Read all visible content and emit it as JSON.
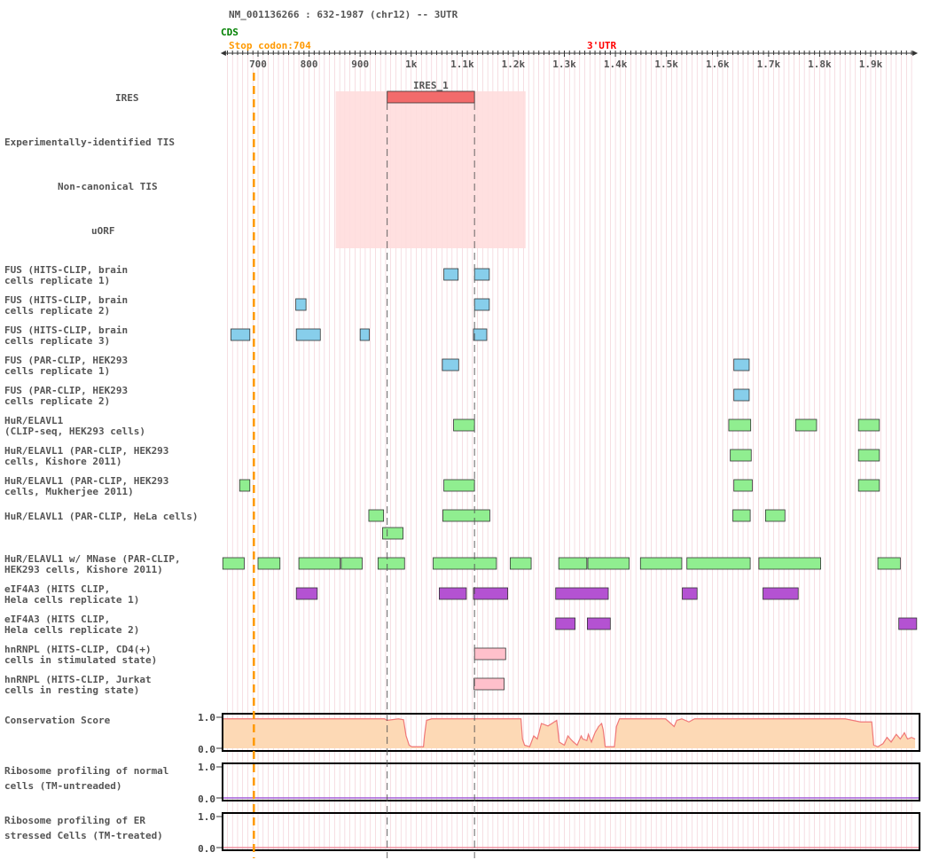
{
  "header": {
    "transcript": "NM_001136266 : 632-1987 (chr12) -- 3UTR",
    "cds_label": "CDS",
    "stop_codon_label": "Stop codon:704",
    "utr_label": "3'UTR"
  },
  "colors": {
    "cds": "#008000",
    "stop": "#ff9900",
    "utr": "#ff0000",
    "ires_fill": "#f26b6b",
    "ires_region": "#ffdddd",
    "fus": "#87ceeb",
    "hur": "#90ee90",
    "eif4a3": "#b452d2",
    "hnrnpl": "#ffc0cb",
    "conservation_fill": "#fdd9b5",
    "conservation_line": "#f07878",
    "ribo_normal": "#a05ad6",
    "ribo_er": "#f090a0",
    "grid": "#f0c8d0"
  },
  "chart_data": {
    "type": "genome-track",
    "x_range": [
      632,
      1987
    ],
    "ticks": [
      {
        "pos": 700,
        "label": "700"
      },
      {
        "pos": 800,
        "label": "800"
      },
      {
        "pos": 900,
        "label": "900"
      },
      {
        "pos": 1000,
        "label": "1k"
      },
      {
        "pos": 1100,
        "label": "1.1k"
      },
      {
        "pos": 1200,
        "label": "1.2k"
      },
      {
        "pos": 1300,
        "label": "1.3k"
      },
      {
        "pos": 1400,
        "label": "1.4k"
      },
      {
        "pos": 1500,
        "label": "1.5k"
      },
      {
        "pos": 1600,
        "label": "1.6k"
      },
      {
        "pos": 1700,
        "label": "1.7k"
      },
      {
        "pos": 1800,
        "label": "1.8k"
      },
      {
        "pos": 1900,
        "label": "1.9k"
      }
    ],
    "stop_codon": 704,
    "ires": {
      "name": "IRES_1",
      "start": 953,
      "end": 1124,
      "region_start": 852,
      "region_end": 1224
    },
    "tracks": [
      {
        "label": [
          "IRES"
        ],
        "type": "ires",
        "features": []
      },
      {
        "label": [
          "Experimentally-identified TIS"
        ],
        "features": []
      },
      {
        "label": [
          "Non-canonical TIS"
        ],
        "features": []
      },
      {
        "label": [
          "uORF"
        ],
        "features": []
      },
      {
        "label": [
          "FUS (HITS-CLIP, brain",
          "cells replicate 1)"
        ],
        "color": "fus",
        "features": [
          [
            1064,
            1092
          ],
          [
            1124,
            1153
          ]
        ]
      },
      {
        "label": [
          "FUS (HITS-CLIP, brain",
          "cells replicate 2)"
        ],
        "color": "fus",
        "features": [
          [
            774,
            794
          ],
          [
            1124,
            1153
          ]
        ]
      },
      {
        "label": [
          "FUS (HITS-CLIP, brain",
          "cells replicate 3)"
        ],
        "color": "fus",
        "features": [
          [
            647,
            684
          ],
          [
            775,
            822
          ],
          [
            900,
            918
          ],
          [
            1122,
            1148
          ]
        ]
      },
      {
        "label": [
          "FUS (PAR-CLIP, HEK293",
          "cells replicate 1)"
        ],
        "color": "fus",
        "features": [
          [
            1061,
            1093
          ],
          [
            1632,
            1662
          ]
        ]
      },
      {
        "label": [
          "FUS (PAR-CLIP, HEK293",
          "cells replicate 2)"
        ],
        "color": "fus",
        "features": [
          [
            1632,
            1662
          ]
        ]
      },
      {
        "label": [
          "HuR/ELAVL1",
          "(CLIP-seq, HEK293 cells)"
        ],
        "color": "hur",
        "features": [
          [
            1083,
            1124
          ],
          [
            1622,
            1665
          ],
          [
            1753,
            1794
          ],
          [
            1876,
            1917
          ]
        ]
      },
      {
        "label": [
          "HuR/ELAVL1 (PAR-CLIP, HEK293",
          "cells, Kishore 2011)"
        ],
        "color": "hur",
        "features": [
          [
            1625,
            1666
          ],
          [
            1876,
            1917
          ]
        ]
      },
      {
        "label": [
          "HuR/ELAVL1 (PAR-CLIP, HEK293",
          "cells, Mukherjee 2011)"
        ],
        "color": "hur",
        "features": [
          [
            664,
            684
          ],
          [
            1064,
            1124
          ],
          [
            1632,
            1668
          ],
          [
            1876,
            1917
          ]
        ]
      },
      {
        "label": [
          "HuR/ELAVL1 (PAR-CLIP, HeLa cells)"
        ],
        "color": "hur",
        "rows": 2,
        "features": [
          [
            917,
            946,
            0
          ],
          [
            1062,
            1154,
            0
          ],
          [
            1630,
            1664,
            0
          ],
          [
            1694,
            1732,
            0
          ],
          [
            944,
            984,
            1
          ]
        ]
      },
      {
        "label": [
          "HuR/ELAVL1 w/ MNase (PAR-CLIP,",
          "HEK293 cells, Kishore 2011)"
        ],
        "color": "hur",
        "features": [
          [
            631,
            673
          ],
          [
            700,
            743
          ],
          [
            780,
            861
          ],
          [
            863,
            904
          ],
          [
            935,
            987
          ],
          [
            1043,
            1167
          ],
          [
            1194,
            1235
          ],
          [
            1289,
            1344
          ],
          [
            1346,
            1427
          ],
          [
            1449,
            1530
          ],
          [
            1540,
            1664
          ],
          [
            1681,
            1802
          ],
          [
            1914,
            1958
          ]
        ]
      },
      {
        "label": [
          "eIF4A3 (HITS CLIP,",
          "Hela cells replicate 1)"
        ],
        "color": "eif4a3",
        "features": [
          [
            775,
            816
          ],
          [
            1055,
            1108
          ],
          [
            1122,
            1189
          ],
          [
            1283,
            1386
          ],
          [
            1531,
            1560
          ],
          [
            1689,
            1758
          ]
        ]
      },
      {
        "label": [
          "eIF4A3 (HITS CLIP,",
          "Hela cells replicate 2)"
        ],
        "color": "eif4a3",
        "features": [
          [
            1283,
            1321
          ],
          [
            1345,
            1390
          ],
          [
            1955,
            1990
          ]
        ]
      },
      {
        "label": [
          "hnRNPL (HITS-CLIP, CD4(+)",
          "cells in stimulated state)"
        ],
        "color": "hnrnpl",
        "features": [
          [
            1124,
            1185
          ]
        ]
      },
      {
        "label": [
          "hnRNPL (HITS-CLIP, Jurkat",
          "cells in resting state)"
        ],
        "color": "hnrnpl",
        "features": [
          [
            1123,
            1182
          ]
        ]
      }
    ],
    "panels": [
      {
        "label": [
          "Conservation Score"
        ],
        "ylim": [
          0,
          1
        ],
        "yticks": [
          "1.0",
          "0.0"
        ],
        "type": "area",
        "points": [
          [
            632,
            0.95
          ],
          [
            900,
            0.95
          ],
          [
            948,
            0.95
          ],
          [
            952,
            0.9
          ],
          [
            975,
            0.95
          ],
          [
            985,
            0.92
          ],
          [
            990,
            0.4
          ],
          [
            996,
            0.1
          ],
          [
            1001,
            0.05
          ],
          [
            1024,
            0.05
          ],
          [
            1026,
            0.4
          ],
          [
            1030,
            0.9
          ],
          [
            1040,
            0.95
          ],
          [
            1215,
            0.95
          ],
          [
            1218,
            0.3
          ],
          [
            1222,
            0.1
          ],
          [
            1232,
            0.05
          ],
          [
            1240,
            0.4
          ],
          [
            1247,
            0.3
          ],
          [
            1255,
            0.8
          ],
          [
            1268,
            0.72
          ],
          [
            1285,
            0.9
          ],
          [
            1290,
            0.2
          ],
          [
            1300,
            0.1
          ],
          [
            1307,
            0.4
          ],
          [
            1312,
            0.3
          ],
          [
            1318,
            0.2
          ],
          [
            1325,
            0.1
          ],
          [
            1333,
            0.4
          ],
          [
            1336,
            0.3
          ],
          [
            1344,
            0.25
          ],
          [
            1347,
            0.45
          ],
          [
            1353,
            0.2
          ],
          [
            1360,
            0.5
          ],
          [
            1367,
            0.7
          ],
          [
            1373,
            0.8
          ],
          [
            1376,
            0.6
          ],
          [
            1380,
            0.05
          ],
          [
            1398,
            0.05
          ],
          [
            1402,
            0.7
          ],
          [
            1408,
            0.95
          ],
          [
            1498,
            0.95
          ],
          [
            1505,
            0.85
          ],
          [
            1515,
            0.7
          ],
          [
            1520,
            0.9
          ],
          [
            1530,
            0.95
          ],
          [
            1544,
            0.85
          ],
          [
            1555,
            0.95
          ],
          [
            1850,
            0.95
          ],
          [
            1880,
            0.85
          ],
          [
            1902,
            0.85
          ],
          [
            1906,
            0.1
          ],
          [
            1914,
            0.05
          ],
          [
            1924,
            0.15
          ],
          [
            1932,
            0.35
          ],
          [
            1940,
            0.2
          ],
          [
            1950,
            0.45
          ],
          [
            1958,
            0.3
          ],
          [
            1966,
            0.5
          ],
          [
            1972,
            0.3
          ],
          [
            1980,
            0.35
          ],
          [
            1987,
            0.3
          ]
        ]
      },
      {
        "label": [
          "Ribosome profiling of normal",
          "cells (TM-untreaded)"
        ],
        "ylim": [
          0,
          1
        ],
        "yticks": [
          "1.0",
          "0.0"
        ],
        "type": "line",
        "color": "ribo_normal",
        "points": []
      },
      {
        "label": [
          "Ribosome profiling of ER",
          "stressed Cells (TM-treated)"
        ],
        "ylim": [
          0,
          1
        ],
        "yticks": [
          "1.0",
          "0.0"
        ],
        "type": "line",
        "color": "ribo_er",
        "points": []
      }
    ]
  }
}
